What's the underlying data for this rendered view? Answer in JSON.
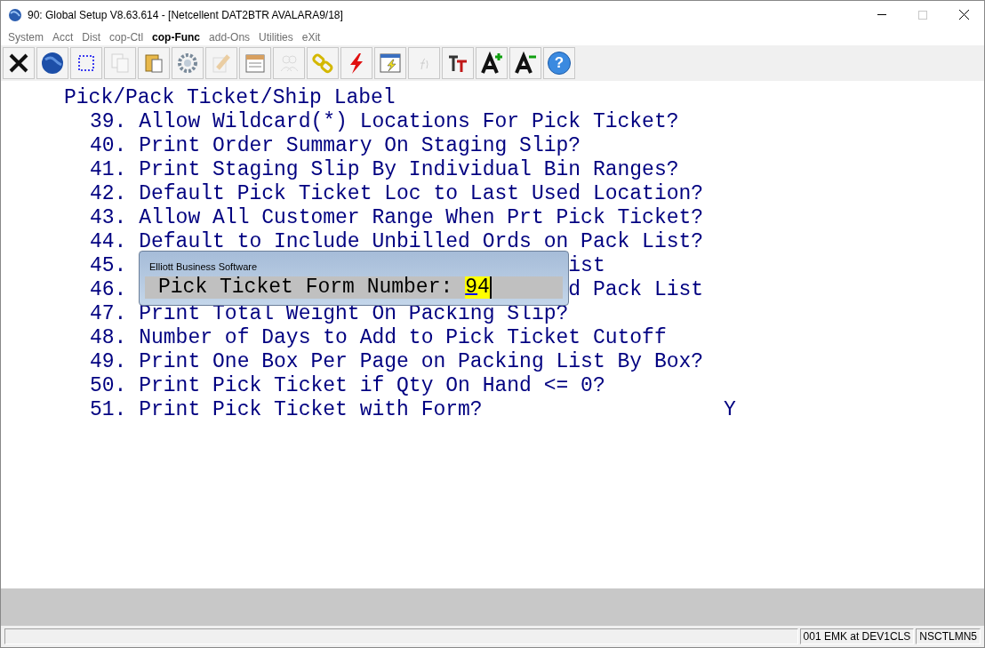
{
  "window": {
    "title": "90: Global Setup V8.63.614 - [Netcellent DAT2BTR AVALARA9/18]",
    "maximize_disabled": true
  },
  "menu": [
    {
      "label": "System",
      "selected": false
    },
    {
      "label": "Acct",
      "selected": false
    },
    {
      "label": "Dist",
      "selected": false
    },
    {
      "label": "cop-Ctl",
      "selected": false
    },
    {
      "label": "cop-Func",
      "selected": true
    },
    {
      "label": "add-Ons",
      "selected": false
    },
    {
      "label": "Utilities",
      "selected": false
    },
    {
      "label": "eXit",
      "selected": false
    }
  ],
  "toolbar": [
    {
      "kind": "close",
      "disabled": false
    },
    {
      "kind": "globe",
      "disabled": false
    },
    {
      "kind": "select",
      "disabled": false
    },
    {
      "kind": "copy",
      "disabled": true
    },
    {
      "kind": "paste",
      "disabled": false
    },
    {
      "kind": "gear",
      "disabled": false
    },
    {
      "kind": "pencil",
      "disabled": true
    },
    {
      "kind": "notes",
      "disabled": false
    },
    {
      "kind": "people",
      "disabled": true
    },
    {
      "kind": "chain",
      "disabled": false
    },
    {
      "kind": "bolt",
      "disabled": false
    },
    {
      "kind": "window-bolt",
      "disabled": false
    },
    {
      "kind": "fx",
      "disabled": true
    },
    {
      "kind": "font",
      "disabled": false
    },
    {
      "kind": "font-up",
      "disabled": false
    },
    {
      "kind": "font-down",
      "disabled": false
    },
    {
      "kind": "help",
      "disabled": false,
      "glyph": "?"
    }
  ],
  "screen": {
    "heading": "Pick/Pack Ticket/Ship Label",
    "items": [
      {
        "kind": "full",
        "text": "39. Allow Wildcard(*) Locations For Pick Ticket?"
      },
      {
        "kind": "full",
        "text": "40. Print Order Summary On Staging Slip?"
      },
      {
        "kind": "full",
        "text": "41. Print Staging Slip By Individual Bin Ranges?"
      },
      {
        "kind": "full",
        "text": "42. Default Pick Ticket Loc to Last Used Location?"
      },
      {
        "kind": "full",
        "text": "43. Allow All Customer Range When Prt Pick Ticket?"
      },
      {
        "kind": "full",
        "text": "44. Default to Include Unbilled Ords on Pack List?"
      },
      {
        "kind": "split",
        "number": "45.",
        "tail": "ist"
      },
      {
        "kind": "split",
        "number": "46.",
        "tail": "d Pack List"
      },
      {
        "kind": "full",
        "text": "47. Print Total Weight On Packing Slip?"
      },
      {
        "kind": "full",
        "text": "48. Number of Days to Add to Pick Ticket Cutoff"
      },
      {
        "kind": "full",
        "text": "49. Print One Box Per Page on Packing List By Box?"
      },
      {
        "kind": "full",
        "text": "50. Print Pick Ticket if Qty On Hand <= 0?"
      },
      {
        "kind": "full",
        "text": "51. Print Pick Ticket with Form?",
        "value": "Y"
      }
    ]
  },
  "dialog": {
    "title": "Elliott Business Software",
    "prompt": "Pick Ticket Form Number:",
    "value": "94"
  },
  "status_bar": [
    "001 EMK at DEV1CLS",
    "NSCTLMN5"
  ]
}
